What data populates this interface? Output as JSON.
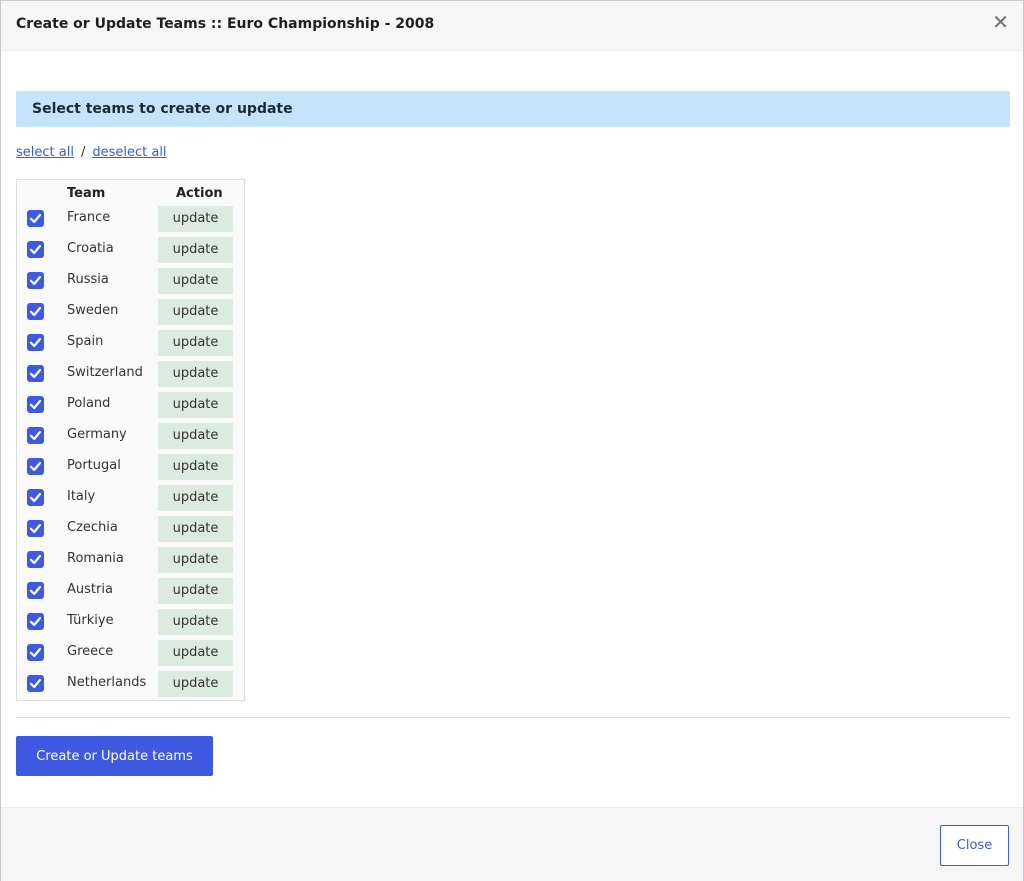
{
  "header": {
    "title": "Create or Update Teams :: Euro Championship - 2008",
    "close_glyph": "✕"
  },
  "banner": {
    "text": "Select teams to create or update"
  },
  "links": {
    "select_all": "select all",
    "separator": "/",
    "deselect_all": "deselect all"
  },
  "table": {
    "headers": {
      "team": "Team",
      "action": "Action"
    },
    "rows": [
      {
        "team": "France",
        "action": "update",
        "checked": true
      },
      {
        "team": "Croatia",
        "action": "update",
        "checked": true
      },
      {
        "team": "Russia",
        "action": "update",
        "checked": true
      },
      {
        "team": "Sweden",
        "action": "update",
        "checked": true
      },
      {
        "team": "Spain",
        "action": "update",
        "checked": true
      },
      {
        "team": "Switzerland",
        "action": "update",
        "checked": true
      },
      {
        "team": "Poland",
        "action": "update",
        "checked": true
      },
      {
        "team": "Germany",
        "action": "update",
        "checked": true
      },
      {
        "team": "Portugal",
        "action": "update",
        "checked": true
      },
      {
        "team": "Italy",
        "action": "update",
        "checked": true
      },
      {
        "team": "Czechia",
        "action": "update",
        "checked": true
      },
      {
        "team": "Romania",
        "action": "update",
        "checked": true
      },
      {
        "team": "Austria",
        "action": "update",
        "checked": true
      },
      {
        "team": "Türkiye",
        "action": "update",
        "checked": true
      },
      {
        "team": "Greece",
        "action": "update",
        "checked": true
      },
      {
        "team": "Netherlands",
        "action": "update",
        "checked": true
      }
    ]
  },
  "buttons": {
    "primary": "Create or Update teams",
    "close": "Close"
  },
  "colors": {
    "accent": "#3d5ae0",
    "banner": "#c3e4fa",
    "badge": "#dcebdf"
  }
}
